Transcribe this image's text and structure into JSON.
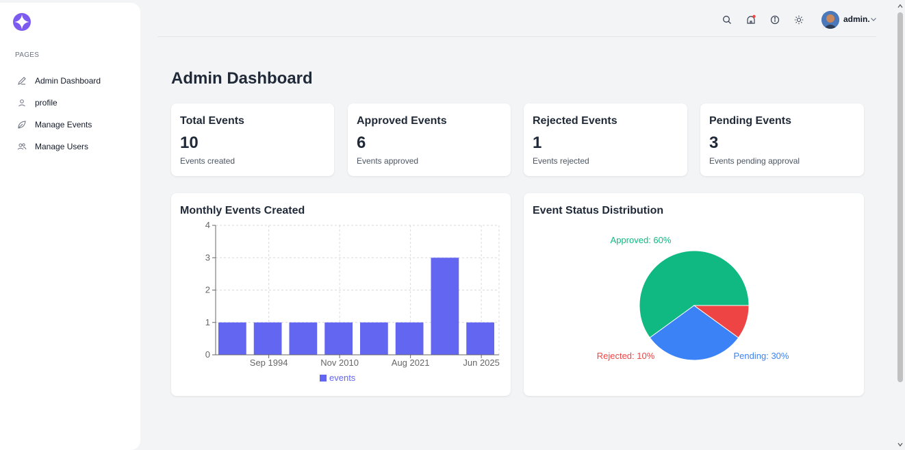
{
  "sidebar": {
    "section_label": "PAGES",
    "items": [
      {
        "label": "Admin Dashboard",
        "icon": "pen-icon"
      },
      {
        "label": "profile",
        "icon": "user-icon"
      },
      {
        "label": "Manage Events",
        "icon": "leaf-icon"
      },
      {
        "label": "Manage Users",
        "icon": "users-icon"
      }
    ]
  },
  "header": {
    "user_name": "admin.",
    "icons": [
      "search-icon",
      "notification-icon",
      "info-icon",
      "theme-toggle-icon",
      "chevron-down-icon"
    ]
  },
  "page": {
    "title": "Admin Dashboard"
  },
  "stats": [
    {
      "title": "Total Events",
      "value": "10",
      "sub": "Events created"
    },
    {
      "title": "Approved Events",
      "value": "6",
      "sub": "Events approved"
    },
    {
      "title": "Rejected Events",
      "value": "1",
      "sub": "Events rejected"
    },
    {
      "title": "Pending Events",
      "value": "3",
      "sub": "Events pending approval"
    }
  ],
  "colors": {
    "bar": "#6366f1",
    "approved": "#10b981",
    "rejected": "#ef4444",
    "pending": "#3b82f6",
    "logo": "#7c5cf0"
  },
  "chart_data": [
    {
      "type": "bar",
      "title": "Monthly Events Created",
      "x_tick_labels": [
        "Sep 1994",
        "Nov 2010",
        "Aug 2021",
        "Jun 2025"
      ],
      "values": [
        1,
        1,
        1,
        1,
        1,
        1,
        3,
        1
      ],
      "series": [
        {
          "name": "events",
          "values": [
            1,
            1,
            1,
            1,
            1,
            1,
            3,
            1
          ]
        }
      ],
      "y_ticks": [
        0,
        1,
        2,
        3,
        4
      ],
      "ylim": [
        0,
        4
      ],
      "grid": true,
      "legend": "bottom"
    },
    {
      "type": "pie",
      "title": "Event Status Distribution",
      "slices": [
        {
          "label": "Approved: 60%",
          "value": 60
        },
        {
          "label": "Pending: 30%",
          "value": 30
        },
        {
          "label": "Rejected: 10%",
          "value": 10
        }
      ]
    }
  ]
}
